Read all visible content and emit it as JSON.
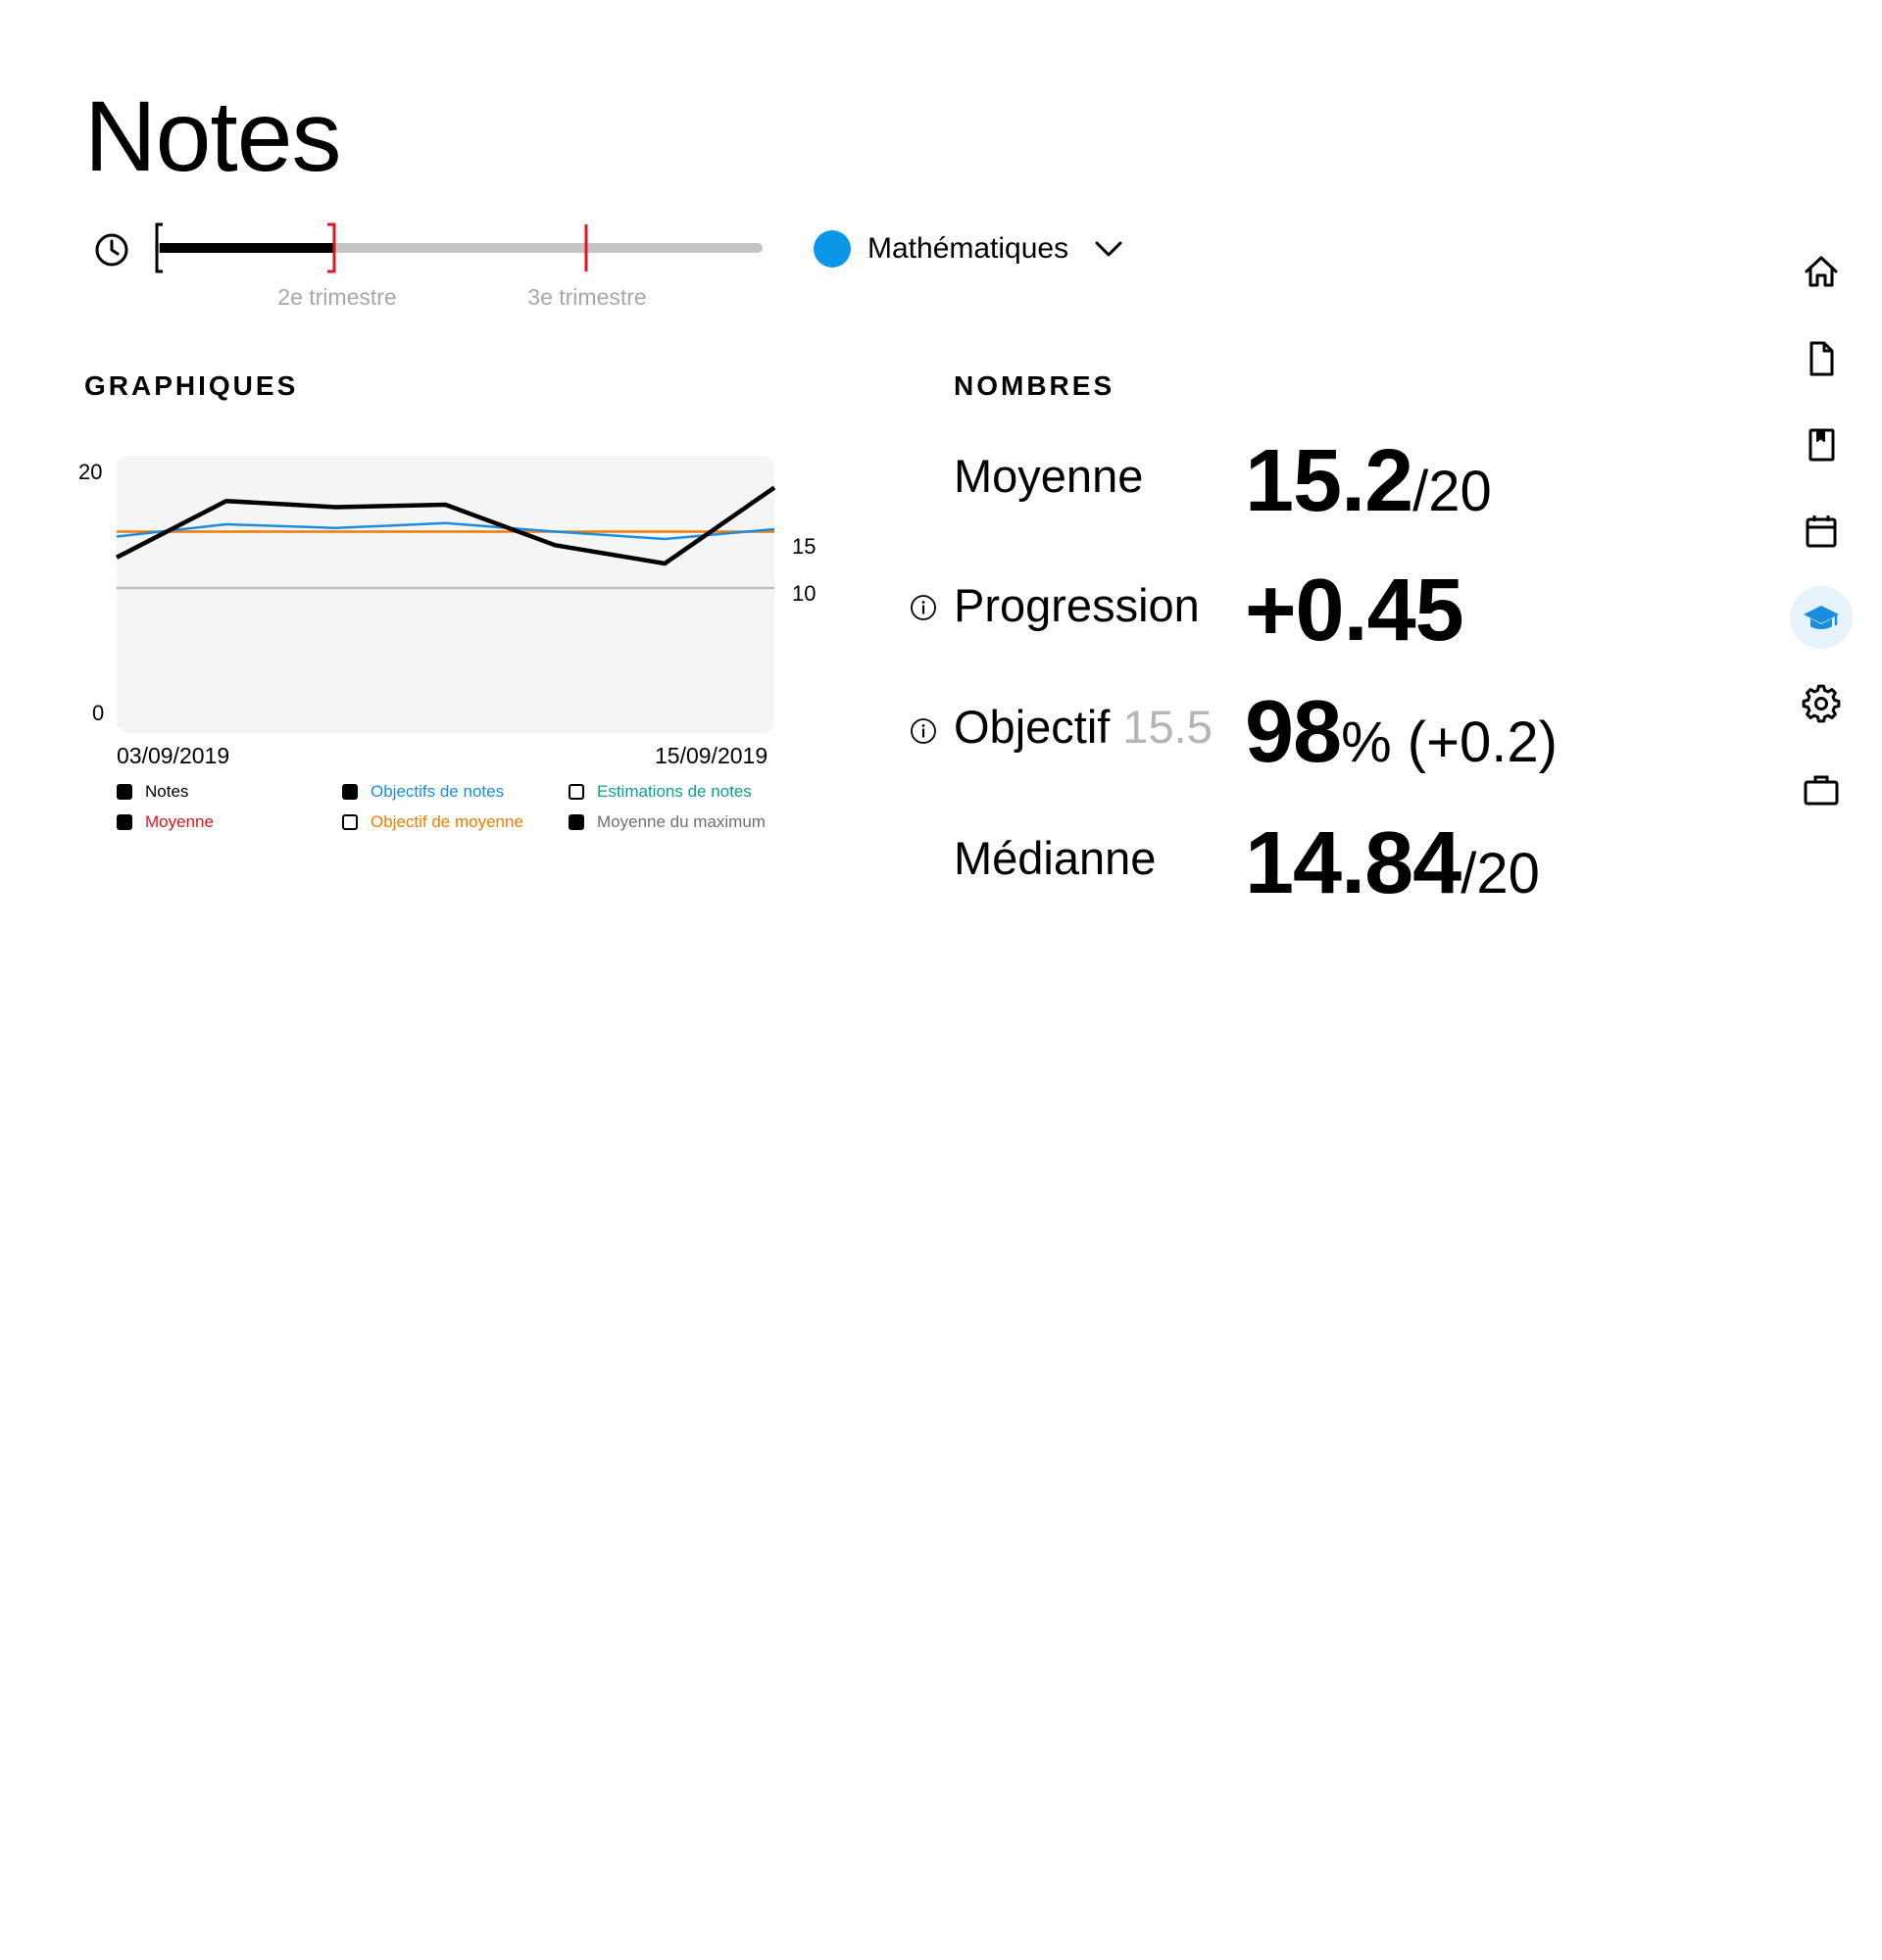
{
  "page": {
    "title": "Notes"
  },
  "period_slider": {
    "labels": [
      "2e trimestre",
      "3e trimestre"
    ]
  },
  "subject": {
    "name": "Mathématiques",
    "color": "#0a97e8"
  },
  "sections": {
    "charts": "GRAPHIQUES",
    "numbers": "NOMBRES"
  },
  "chart_data": {
    "type": "line",
    "x": [
      "03/09/2019",
      "",
      "",
      "",
      "",
      "",
      "",
      "15/09/2019"
    ],
    "ylim": [
      0,
      20
    ],
    "left_ticks": [
      20,
      0
    ],
    "right_ticks": [
      15,
      10
    ],
    "start_label": "03/09/2019",
    "end_label": "15/09/2019",
    "series": [
      {
        "name": "Notes",
        "color": "#000000",
        "values": [
          12.5,
          17.1,
          16.6,
          16.8,
          13.5,
          12.0,
          18.2
        ]
      },
      {
        "name": "Objectifs de notes",
        "color": "#1a8de0",
        "values": [
          14.2,
          15.2,
          14.9,
          15.3,
          14.6,
          14.0,
          14.8
        ]
      },
      {
        "name": "Objectif de moyenne",
        "color": "#f07d00",
        "values": [
          14.6,
          14.6,
          14.6,
          14.6,
          14.6,
          14.6,
          14.6
        ]
      },
      {
        "name": "Moyenne du maximum",
        "color": "#bdbdbd",
        "values": [
          10.0,
          10.0,
          10.0,
          10.0,
          10.0,
          10.0,
          10.0
        ]
      }
    ],
    "legend": [
      {
        "label": "Notes",
        "color": "#000000",
        "checked": true
      },
      {
        "label": "Moyenne",
        "color": "#e0141e",
        "checked": true
      },
      {
        "label": "Objectifs de notes",
        "color": "#1a8de0",
        "checked": true
      },
      {
        "label": "Objectif de moyenne",
        "color": "#f07d00",
        "checked": false
      },
      {
        "label": "Estimations de notes",
        "color": "#0aa08c",
        "checked": false
      },
      {
        "label": "Moyenne du maximum",
        "color": "#707070",
        "checked": true
      }
    ]
  },
  "stats": {
    "moyenne": {
      "label": "Moyenne",
      "value": "15.2",
      "suffix": "/20"
    },
    "progression": {
      "label": "Progression",
      "value": "+0.45"
    },
    "objectif": {
      "label": "Objectif",
      "target": "15.5",
      "value": "98",
      "suffix": "% (+0.2)"
    },
    "mediane": {
      "label": "Médianne",
      "value": "14.84",
      "suffix": "/20"
    }
  },
  "nav": {
    "items": [
      "home-icon",
      "file-icon",
      "book-icon",
      "calendar-icon",
      "graduation-cap-icon",
      "gear-icon",
      "briefcase-icon"
    ],
    "active": "graduation-cap-icon",
    "active_color": "#1a8de0"
  }
}
